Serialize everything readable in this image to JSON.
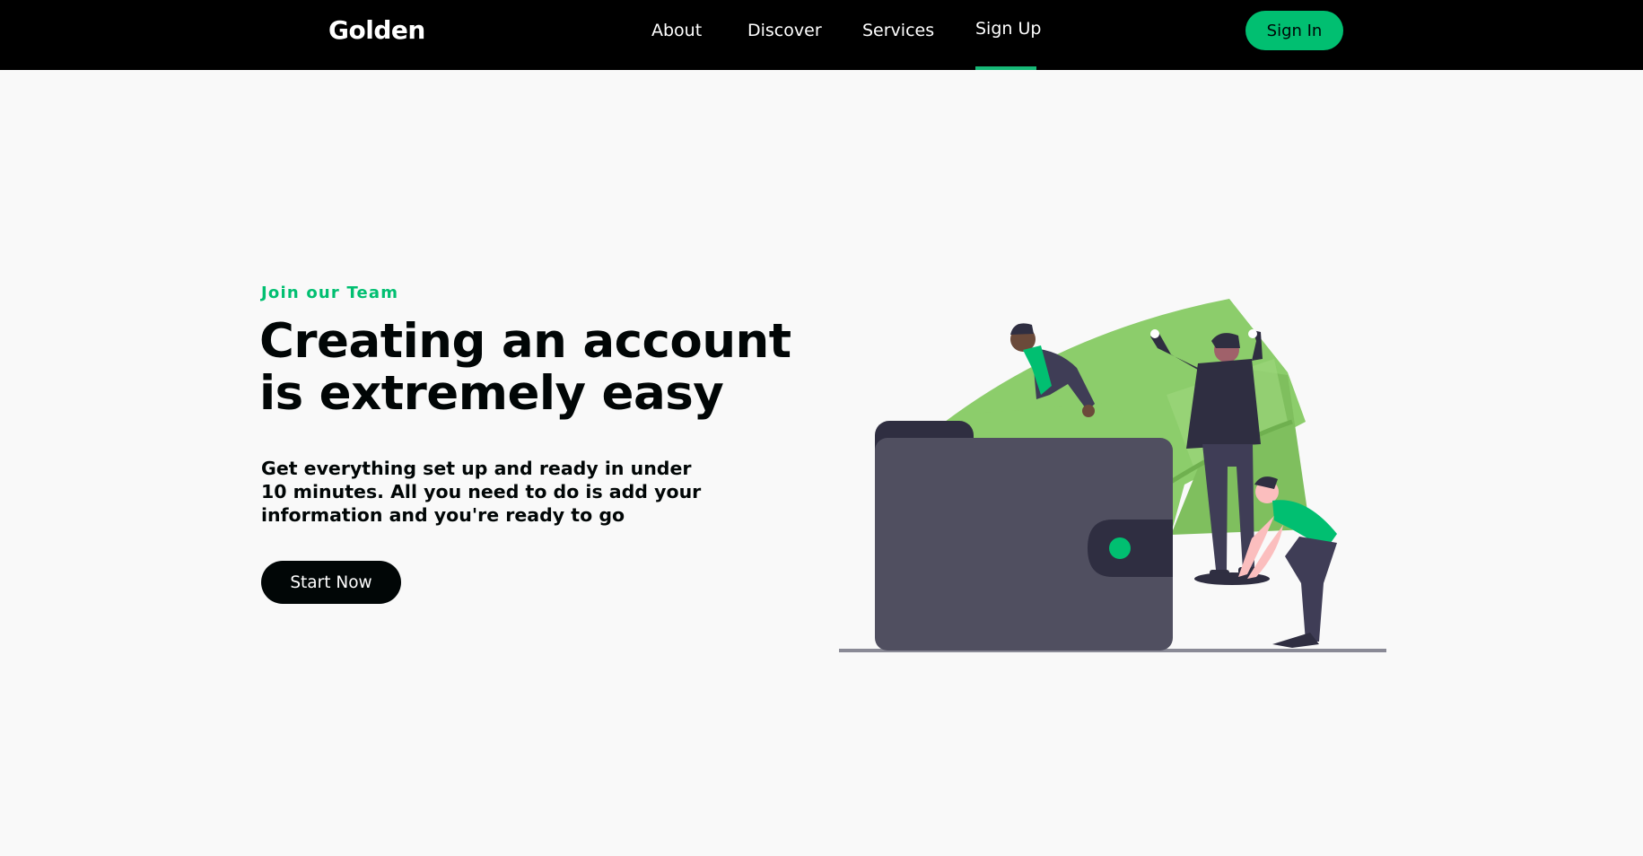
{
  "nav": {
    "logo": "Golden",
    "links": [
      "About",
      "Discover",
      "Services",
      "Sign Up"
    ],
    "active_link": "Sign Up",
    "signin_label": "Sign In"
  },
  "hero": {
    "top_line": "Join our Team",
    "heading_line1": "Creating an account",
    "heading_line2": "is extremely easy",
    "description": "Get everything set up and ready in under 10 minutes. All you need to do is add your information and you're ready to go",
    "button_label": "Start Now"
  },
  "colors": {
    "accent": "#01bf71",
    "navbar_bg": "#000000",
    "page_bg": "#f9f9f9",
    "text_dark": "#010606"
  },
  "icons": {
    "illustration": "wallet-money-illustration"
  }
}
